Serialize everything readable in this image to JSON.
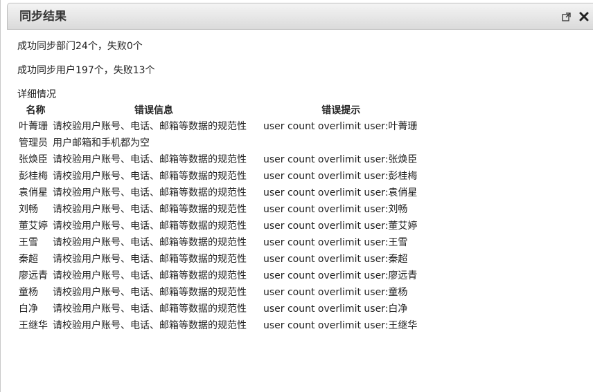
{
  "dialog": {
    "title": "同步结果",
    "popout_icon": "external-link-icon",
    "close_icon": "close-icon"
  },
  "summary": {
    "departments": "成功同步部门24个，失败0个",
    "users": "成功同步用户197个，失败13个"
  },
  "details": {
    "label": "详细情况",
    "headers": {
      "name": "名称",
      "message": "错误信息",
      "hint": "错误提示"
    },
    "rows": [
      {
        "name": "叶菁珊",
        "message": "请校验用户账号、电话、邮箱等数据的规范性",
        "hint": "user count overlimit user:叶菁珊"
      },
      {
        "name": "管理员",
        "message": "用户邮箱和手机都为空",
        "hint": ""
      },
      {
        "name": "张焕臣",
        "message": "请校验用户账号、电话、邮箱等数据的规范性",
        "hint": "user count overlimit user:张焕臣"
      },
      {
        "name": "彭桂梅",
        "message": "请校验用户账号、电话、邮箱等数据的规范性",
        "hint": "user count overlimit user:彭桂梅"
      },
      {
        "name": "袁俏星",
        "message": "请校验用户账号、电话、邮箱等数据的规范性",
        "hint": "user count overlimit user:袁俏星"
      },
      {
        "name": "刘畅",
        "message": "请校验用户账号、电话、邮箱等数据的规范性",
        "hint": "user count overlimit user:刘畅"
      },
      {
        "name": "董艾婷",
        "message": "请校验用户账号、电话、邮箱等数据的规范性",
        "hint": "user count overlimit user:董艾婷"
      },
      {
        "name": "王雪",
        "message": "请校验用户账号、电话、邮箱等数据的规范性",
        "hint": "user count overlimit user:王雪"
      },
      {
        "name": "秦超",
        "message": "请校验用户账号、电话、邮箱等数据的规范性",
        "hint": "user count overlimit user:秦超"
      },
      {
        "name": "廖远青",
        "message": "请校验用户账号、电话、邮箱等数据的规范性",
        "hint": "user count overlimit user:廖远青"
      },
      {
        "name": "童杨",
        "message": "请校验用户账号、电话、邮箱等数据的规范性",
        "hint": "user count overlimit user:童杨"
      },
      {
        "name": "白净",
        "message": "请校验用户账号、电话、邮箱等数据的规范性",
        "hint": "user count overlimit user:白净"
      },
      {
        "name": "王继华",
        "message": "请校验用户账号、电话、邮箱等数据的规范性",
        "hint": "user count overlimit user:王继华"
      }
    ]
  }
}
